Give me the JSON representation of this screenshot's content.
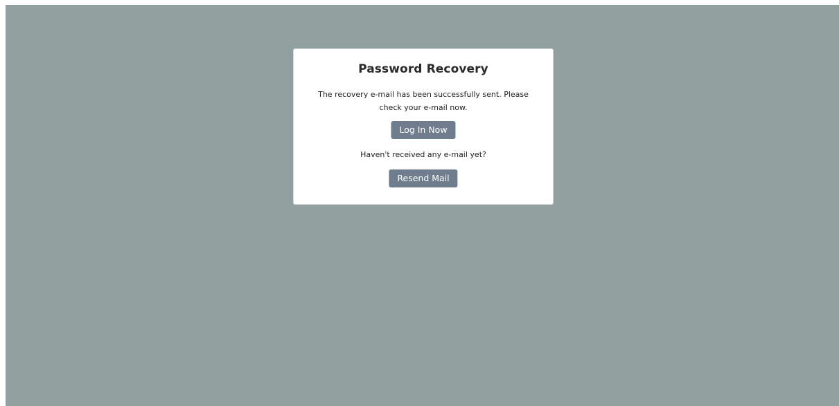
{
  "card": {
    "title": "Password Recovery",
    "message": "The recovery e-mail has been successfully sent. Please check your e-mail now.",
    "login_button": "Log In Now",
    "resend_prompt": "Haven't received any e-mail yet?",
    "resend_button": "Resend Mail"
  },
  "colors": {
    "background": "#8fa09f",
    "card": "#ffffff",
    "button": "#6f7d8e",
    "button_text": "#ffffff",
    "text": "#222222"
  }
}
